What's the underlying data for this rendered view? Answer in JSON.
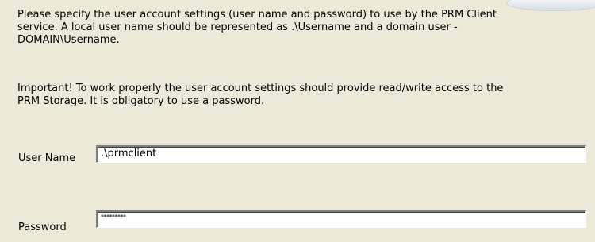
{
  "info_text": "Please specify the user account settings (user name and password) to use by the PRM Client\nservice. A local user name should be represented as .\\Username and a domain user -\nDOMAIN\\Username.",
  "important_text": "Important! To work properly the user account settings should provide read/write access to the\nPRM Storage. It is obligatory to use a password.",
  "fields": {
    "username": {
      "label": "User Name",
      "value": ".\\prmclient"
    },
    "password": {
      "label": "Password",
      "value": "*********"
    }
  },
  "colors": {
    "background": "#ece9d8",
    "field_background": "#ffffff"
  }
}
